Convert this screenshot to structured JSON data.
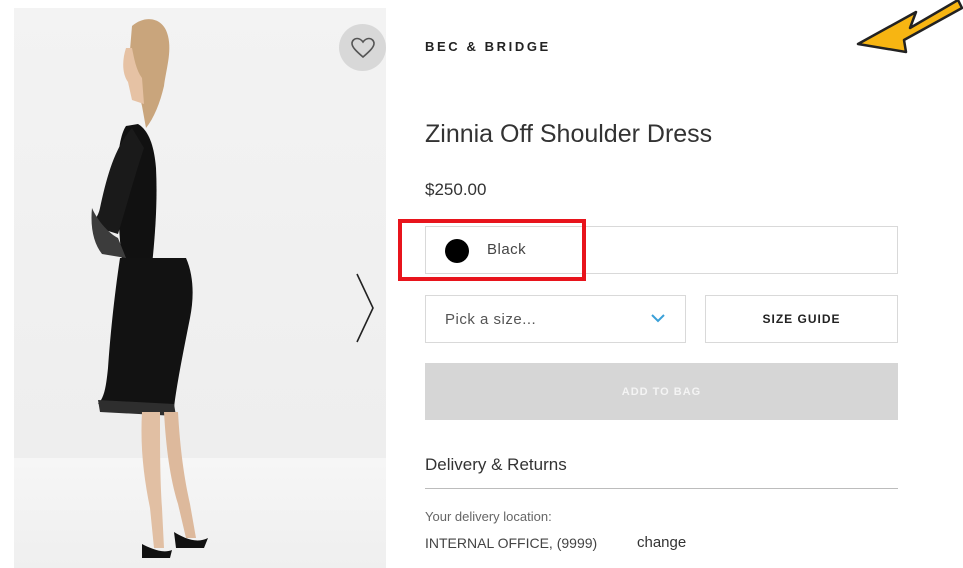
{
  "brand": "BEC & BRIDGE",
  "product": {
    "title": "Zinnia Off Shoulder Dress",
    "price": "$250.00"
  },
  "color_select": {
    "selected": "Black",
    "swatch_color": "#000000"
  },
  "size_select": {
    "placeholder": "Pick a size..."
  },
  "size_guide_label": "SIZE GUIDE",
  "add_to_bag_label": "ADD TO BAG",
  "delivery": {
    "heading": "Delivery & Returns",
    "location_label": "Your delivery location:",
    "location_value": "INTERNAL OFFICE, (9999)",
    "change_link": "change"
  },
  "icons": {
    "favorite": "heart-icon",
    "next": "chevron-right-icon",
    "dropdown": "chevron-down-icon",
    "annotation": "arrow-icon"
  },
  "colors": {
    "highlight_border": "#e8141c",
    "annotation_arrow": "#f7b512",
    "dropdown_chevron": "#3aa0d8",
    "add_to_bag_disabled": "#d6d6d6"
  }
}
